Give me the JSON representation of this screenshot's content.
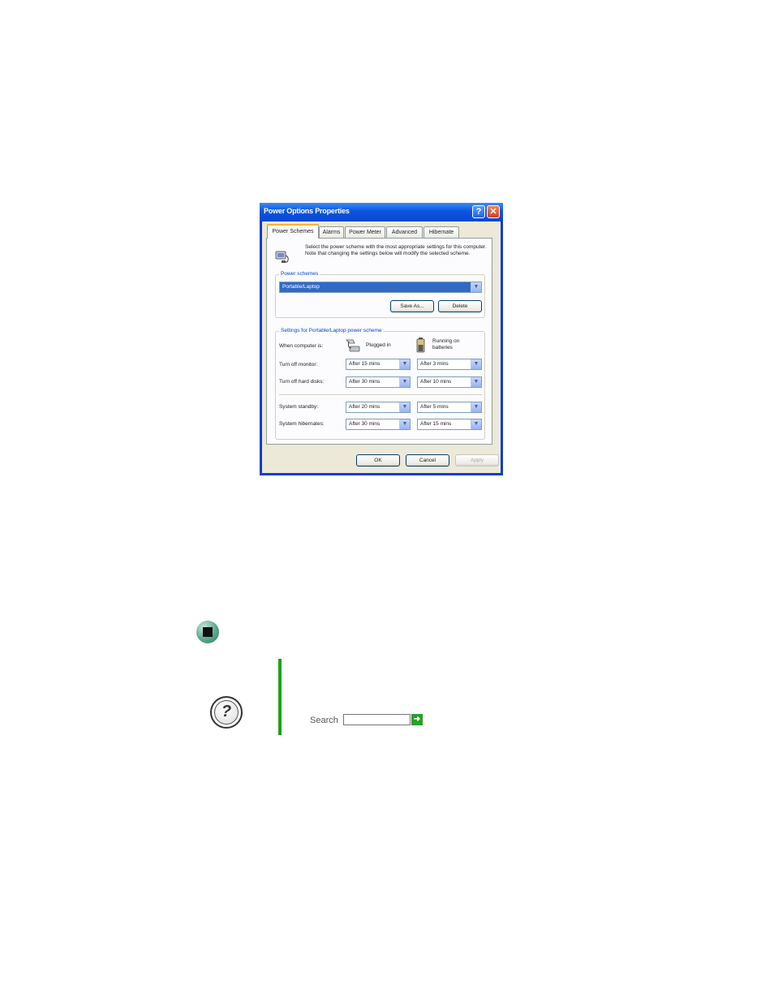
{
  "dialog": {
    "title": "Power Options Properties",
    "help_glyph": "?",
    "close_glyph": "✕",
    "tabs": [
      "Power Schemes",
      "Alarms",
      "Power Meter",
      "Advanced",
      "Hibernate"
    ],
    "description": "Select the power scheme with the most appropriate settings for this computer. Note that changing the settings below will modify the selected scheme.",
    "schemes_group": {
      "label": "Power schemes",
      "selected": "Portable/Laptop",
      "save_as": "Save As...",
      "delete": "Delete"
    },
    "settings_group": {
      "label": "Settings for Portable/Laptop power scheme",
      "when_label": "When computer is:",
      "plugged_in": "Plugged in",
      "on_batteries": "Running on batteries",
      "rows": [
        {
          "label": "Turn off monitor:",
          "plugged": "After 15 mins",
          "battery": "After 3 mins"
        },
        {
          "label": "Turn off hard disks:",
          "plugged": "After 30 mins",
          "battery": "After 10 mins"
        },
        {
          "label": "System standby:",
          "plugged": "After 20 mins",
          "battery": "After 5 mins"
        },
        {
          "label": "System hibernates:",
          "plugged": "After 30 mins",
          "battery": "After 15 mins"
        }
      ]
    },
    "buttons": {
      "ok": "OK",
      "cancel": "Cancel",
      "apply": "Apply"
    }
  },
  "help_panel": {
    "search_label": "Search",
    "search_value": "",
    "go_glyph": "➜",
    "help_glyph": "?"
  },
  "colors": {
    "titlebar": "#0b55e0",
    "accent_green": "#1aa31a"
  }
}
